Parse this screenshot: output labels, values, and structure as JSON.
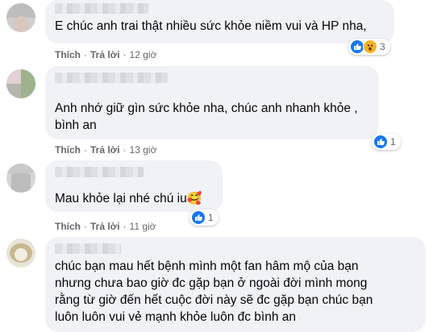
{
  "actions": {
    "like": "Thích",
    "reply": "Trả lời",
    "separator": "·"
  },
  "comments": [
    {
      "text": "E chúc anh trai thật nhiều sức khỏe niềm vui và HP nha,",
      "time": "12 giờ",
      "reactions": [
        "like-icon",
        "wow-icon"
      ],
      "reaction_count": "3"
    },
    {
      "text": "Anh nhớ giữ gìn sức khỏe nha, chúc anh nhanh khỏe ,\nbình an",
      "time": "13 giờ",
      "reactions": [
        "like-icon"
      ],
      "reaction_count": "1"
    },
    {
      "text": "Mau khỏe lại nhé chú iu",
      "emoji": "🥰",
      "time": "11 giờ",
      "reactions": [
        "like-icon"
      ],
      "reaction_count": "1"
    },
    {
      "text": "chúc bạn mau hết bệnh mình một fan hâm mộ của bạn\nnhưng chưa bao giờ đc gặp bạn ở ngoài đời mình mong\nrằng từ giờ đến hết cuộc đời này sẽ đc gặp bạn chúc bạn\nluôn luôn vui vẻ mạnh khỏe luôn đc bình an"
    }
  ],
  "colors": {
    "bubble": "#f0f2f5",
    "text": "#050505",
    "meta": "#65676b",
    "like_blue": "#1877f2",
    "wow_yellow": "#f7b125"
  }
}
